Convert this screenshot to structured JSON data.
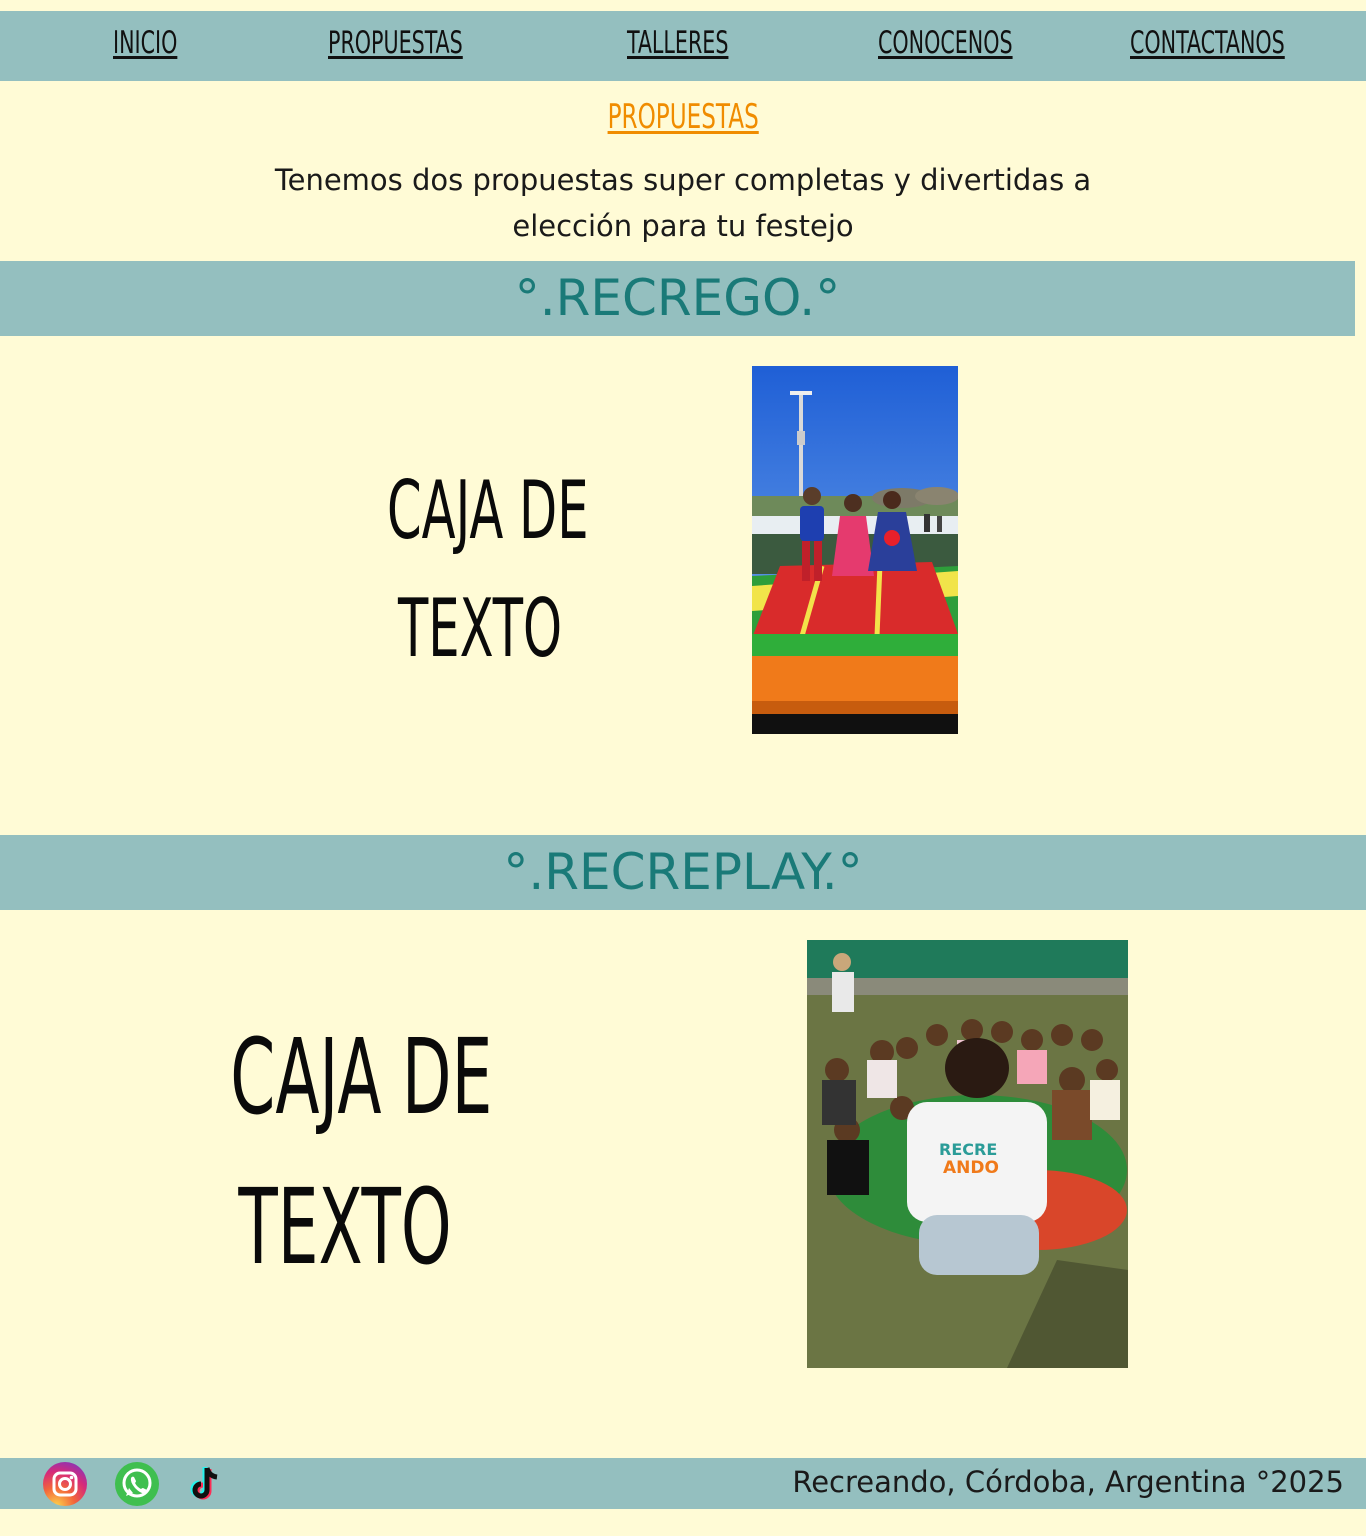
{
  "nav": {
    "items": [
      {
        "label": "INICIO"
      },
      {
        "label": "PROPUESTAS"
      },
      {
        "label": "TALLERES"
      },
      {
        "label": "CONOCENOS"
      },
      {
        "label": "CONTACTANOS"
      }
    ]
  },
  "page": {
    "heading": "PROPUESTAS",
    "intro_line1": "Tenemos dos propuestas super completas y divertidas a",
    "intro_line2": "elección  para tu festejo"
  },
  "sections": [
    {
      "title": "°.RECREGO.°",
      "textbox_line1": "CAJA DE",
      "textbox_line2": "TEXTO"
    },
    {
      "title": "°.RECREPLAY.°",
      "textbox_line1": "CAJA DE",
      "textbox_line2": "TEXTO",
      "shirt_logo_top": "RECRE",
      "shirt_logo_bottom": "ANDO"
    }
  ],
  "footer": {
    "social_icons": [
      "instagram-icon",
      "whatsapp-icon",
      "tiktok-icon"
    ],
    "text": "Recreando, Córdoba, Argentina °2025"
  },
  "colors": {
    "background": "#fffbd6",
    "band": "#94bfbf",
    "section_title": "#1a7a78",
    "heading_accent": "#f08c00"
  }
}
